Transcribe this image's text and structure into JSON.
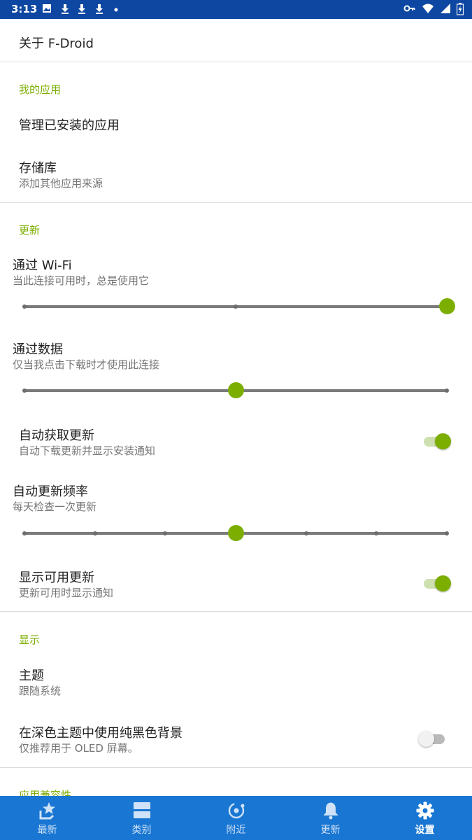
{
  "status_bar": {
    "time": "3:13",
    "left_icons": [
      "image-icon",
      "download-icon",
      "download-icon",
      "download-icon",
      "dot-icon"
    ],
    "right_icons": [
      "key-icon",
      "wifi-icon",
      "signal-icon",
      "battery-icon"
    ]
  },
  "settings": {
    "about": {
      "title": "关于 F-Droid"
    },
    "my_apps": {
      "header": "我的应用",
      "manage": {
        "title": "管理已安装的应用"
      },
      "repos": {
        "title": "存储库",
        "summary": "添加其他应用来源"
      }
    },
    "updates": {
      "header": "更新",
      "wifi": {
        "title": "通过 Wi-Fi",
        "summary": "当此连接可用时，总是使用它",
        "level": 1.0,
        "steps": 3
      },
      "data": {
        "title": "通过数据",
        "summary": "仅当我点击下载时才使用此连接",
        "level": 0.5,
        "steps": 3
      },
      "auto_fetch": {
        "title": "自动获取更新",
        "summary": "自动下载更新并显示安装通知",
        "checked": true
      },
      "frequency": {
        "title": "自动更新频率",
        "summary": "每天检查一次更新",
        "level": 0.5,
        "steps": 7
      },
      "show_updates": {
        "title": "显示可用更新",
        "summary": "更新可用时显示通知",
        "checked": true
      }
    },
    "display": {
      "header": "显示",
      "theme": {
        "title": "主题",
        "summary": "跟随系统"
      },
      "pure_black": {
        "title": "在深色主题中使用纯黑色背景",
        "summary": "仅推荐用于 OLED 屏幕。",
        "checked": false
      }
    },
    "compat": {
      "header": "应用兼容性"
    }
  },
  "bottom_nav": [
    {
      "label": "最新",
      "icon": "star-icon",
      "active": false
    },
    {
      "label": "类别",
      "icon": "categories-icon",
      "active": false
    },
    {
      "label": "附近",
      "icon": "nearby-icon",
      "active": false
    },
    {
      "label": "更新",
      "icon": "bell-icon",
      "active": false
    },
    {
      "label": "设置",
      "icon": "gear-icon",
      "active": true
    }
  ],
  "colors": {
    "accent": "#7cae00",
    "status_bar": "#0d47a1",
    "bottom_nav": "#1976d2"
  }
}
